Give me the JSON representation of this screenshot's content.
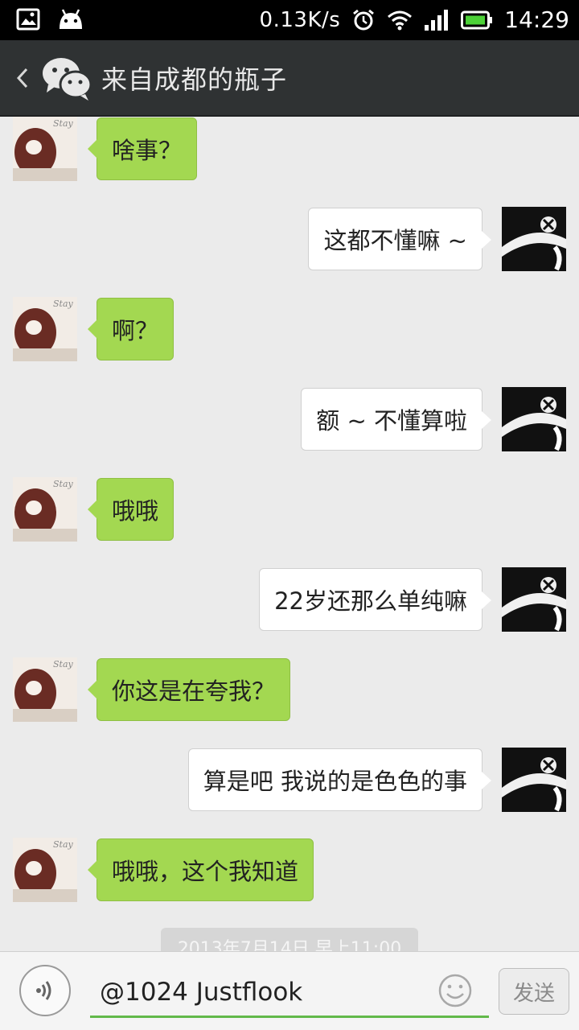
{
  "status_bar": {
    "net_speed": "0.13K/s",
    "time": "14:29"
  },
  "header": {
    "title": "来自成都的瓶子"
  },
  "messages": [
    {
      "side": "left",
      "text": "啥事？"
    },
    {
      "side": "right",
      "text": "这都不懂嘛 ~"
    },
    {
      "side": "left",
      "text": "啊？"
    },
    {
      "side": "right",
      "text": "额 ~ 不懂算啦"
    },
    {
      "side": "left",
      "text": "哦哦"
    },
    {
      "side": "right",
      "text": "22岁还那么单纯嘛"
    },
    {
      "side": "left",
      "text": "你这是在夸我？"
    },
    {
      "side": "right",
      "text": "算是吧  我说的是色色的事"
    },
    {
      "side": "left",
      "text": "哦哦，这个我知道"
    }
  ],
  "timestamp": "2013年7月14日 早上11:00",
  "input": {
    "value": "@1024 Justflook",
    "send_label": "发送"
  },
  "colors": {
    "header_bg": "#2f3233",
    "left_bubble": "#a3d851",
    "right_bubble": "#ffffff",
    "input_underline": "#62b94a"
  }
}
